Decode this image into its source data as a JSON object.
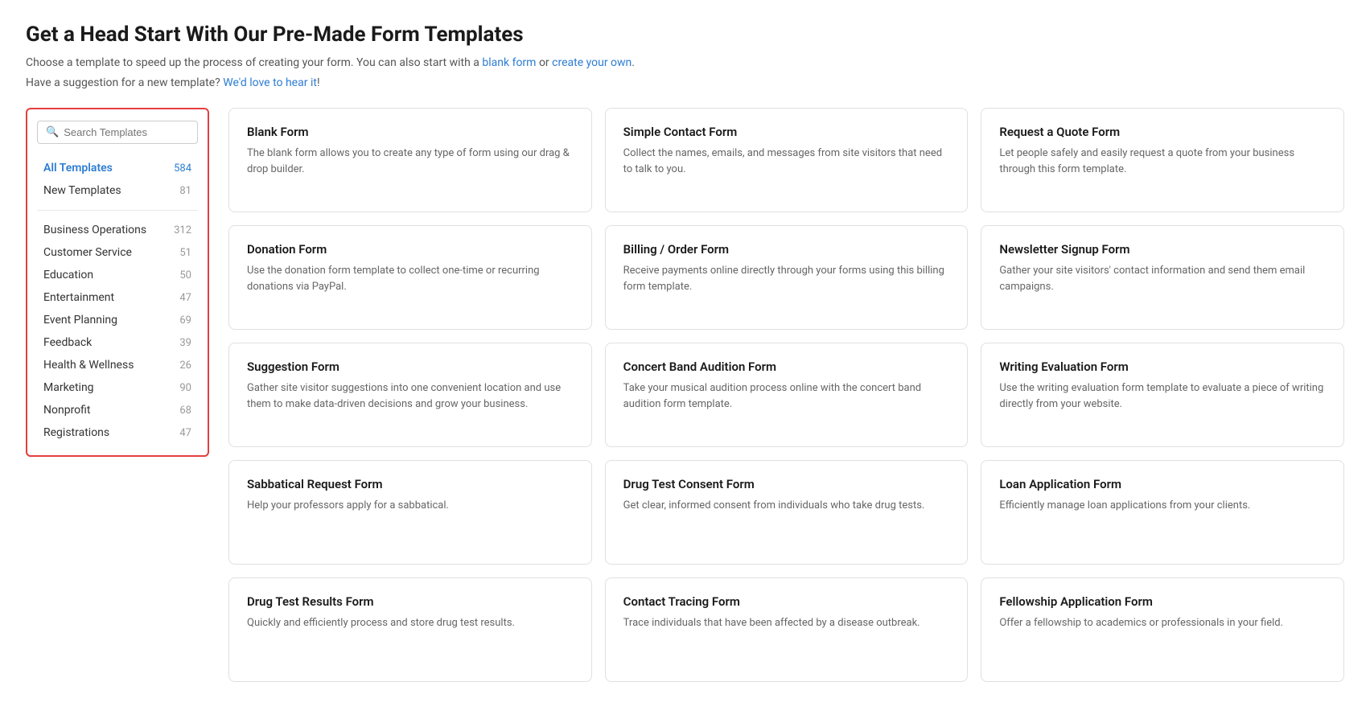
{
  "page": {
    "title": "Get a Head Start With Our Pre-Made Form Templates",
    "subtitle_line1": "Choose a template to speed up the process of creating your form. You can also start with a",
    "blank_form_link": "blank form",
    "subtitle_or": "or",
    "create_own_link": "create your own",
    "subtitle_end": ".",
    "subtitle_line2": "Have a suggestion for a new template?",
    "love_to_hear_link": "We'd love to hear it",
    "subtitle_end2": "!"
  },
  "sidebar": {
    "search_placeholder": "Search Templates",
    "items": [
      {
        "label": "All Templates",
        "count": "584",
        "active": true
      },
      {
        "label": "New Templates",
        "count": "81",
        "active": false
      }
    ],
    "categories": [
      {
        "label": "Business Operations",
        "count": "312"
      },
      {
        "label": "Customer Service",
        "count": "51"
      },
      {
        "label": "Education",
        "count": "50"
      },
      {
        "label": "Entertainment",
        "count": "47"
      },
      {
        "label": "Event Planning",
        "count": "69"
      },
      {
        "label": "Feedback",
        "count": "39"
      },
      {
        "label": "Health & Wellness",
        "count": "26"
      },
      {
        "label": "Marketing",
        "count": "90"
      },
      {
        "label": "Nonprofit",
        "count": "68"
      },
      {
        "label": "Registrations",
        "count": "47"
      }
    ]
  },
  "templates": [
    {
      "title": "Blank Form",
      "desc": "The blank form allows you to create any type of form using our drag & drop builder."
    },
    {
      "title": "Simple Contact Form",
      "desc": "Collect the names, emails, and messages from site visitors that need to talk to you."
    },
    {
      "title": "Request a Quote Form",
      "desc": "Let people safely and easily request a quote from your business through this form template."
    },
    {
      "title": "Donation Form",
      "desc": "Use the donation form template to collect one-time or recurring donations via PayPal."
    },
    {
      "title": "Billing / Order Form",
      "desc": "Receive payments online directly through your forms using this billing form template."
    },
    {
      "title": "Newsletter Signup Form",
      "desc": "Gather your site visitors' contact information and send them email campaigns."
    },
    {
      "title": "Suggestion Form",
      "desc": "Gather site visitor suggestions into one convenient location and use them to make data-driven decisions and grow your business."
    },
    {
      "title": "Concert Band Audition Form",
      "desc": "Take your musical audition process online with the concert band audition form template."
    },
    {
      "title": "Writing Evaluation Form",
      "desc": "Use the writing evaluation form template to evaluate a piece of writing directly from your website."
    },
    {
      "title": "Sabbatical Request Form",
      "desc": "Help your professors apply for a sabbatical."
    },
    {
      "title": "Drug Test Consent Form",
      "desc": "Get clear, informed consent from individuals who take drug tests."
    },
    {
      "title": "Loan Application Form",
      "desc": "Efficiently manage loan applications from your clients."
    },
    {
      "title": "Drug Test Results Form",
      "desc": "Quickly and efficiently process and store drug test results."
    },
    {
      "title": "Contact Tracing Form",
      "desc": "Trace individuals that have been affected by a disease outbreak."
    },
    {
      "title": "Fellowship Application Form",
      "desc": "Offer a fellowship to academics or professionals in your field."
    }
  ]
}
